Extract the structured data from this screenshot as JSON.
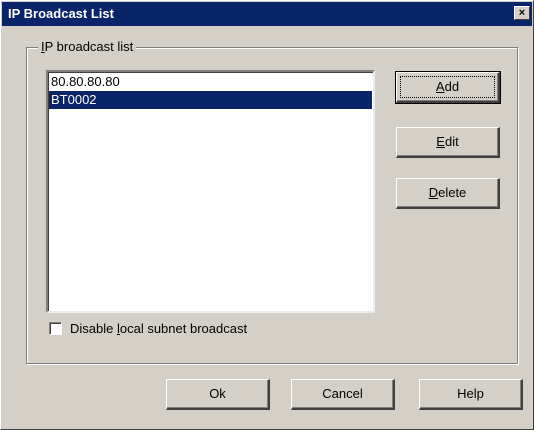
{
  "window": {
    "title": "IP Broadcast List",
    "close_label": "×"
  },
  "group": {
    "legend_prefix": "I",
    "legend_rest": "P broadcast list"
  },
  "list": {
    "items": [
      {
        "label": "80.80.80.80",
        "selected": false
      },
      {
        "label": "BT0002",
        "selected": true
      }
    ]
  },
  "buttons": {
    "add": {
      "u": "A",
      "rest": "dd"
    },
    "edit": {
      "u": "E",
      "rest": "dit"
    },
    "delete": {
      "u": "D",
      "rest": "elete"
    },
    "ok": "Ok",
    "cancel": "Cancel",
    "help": "Help"
  },
  "checkbox": {
    "label_pre": "Disable ",
    "label_u": "l",
    "label_post": "ocal subnet broadcast",
    "checked": false
  },
  "colors": {
    "titlebar": "#0a246a",
    "selection": "#0a246a",
    "face": "#d4d0c8"
  }
}
